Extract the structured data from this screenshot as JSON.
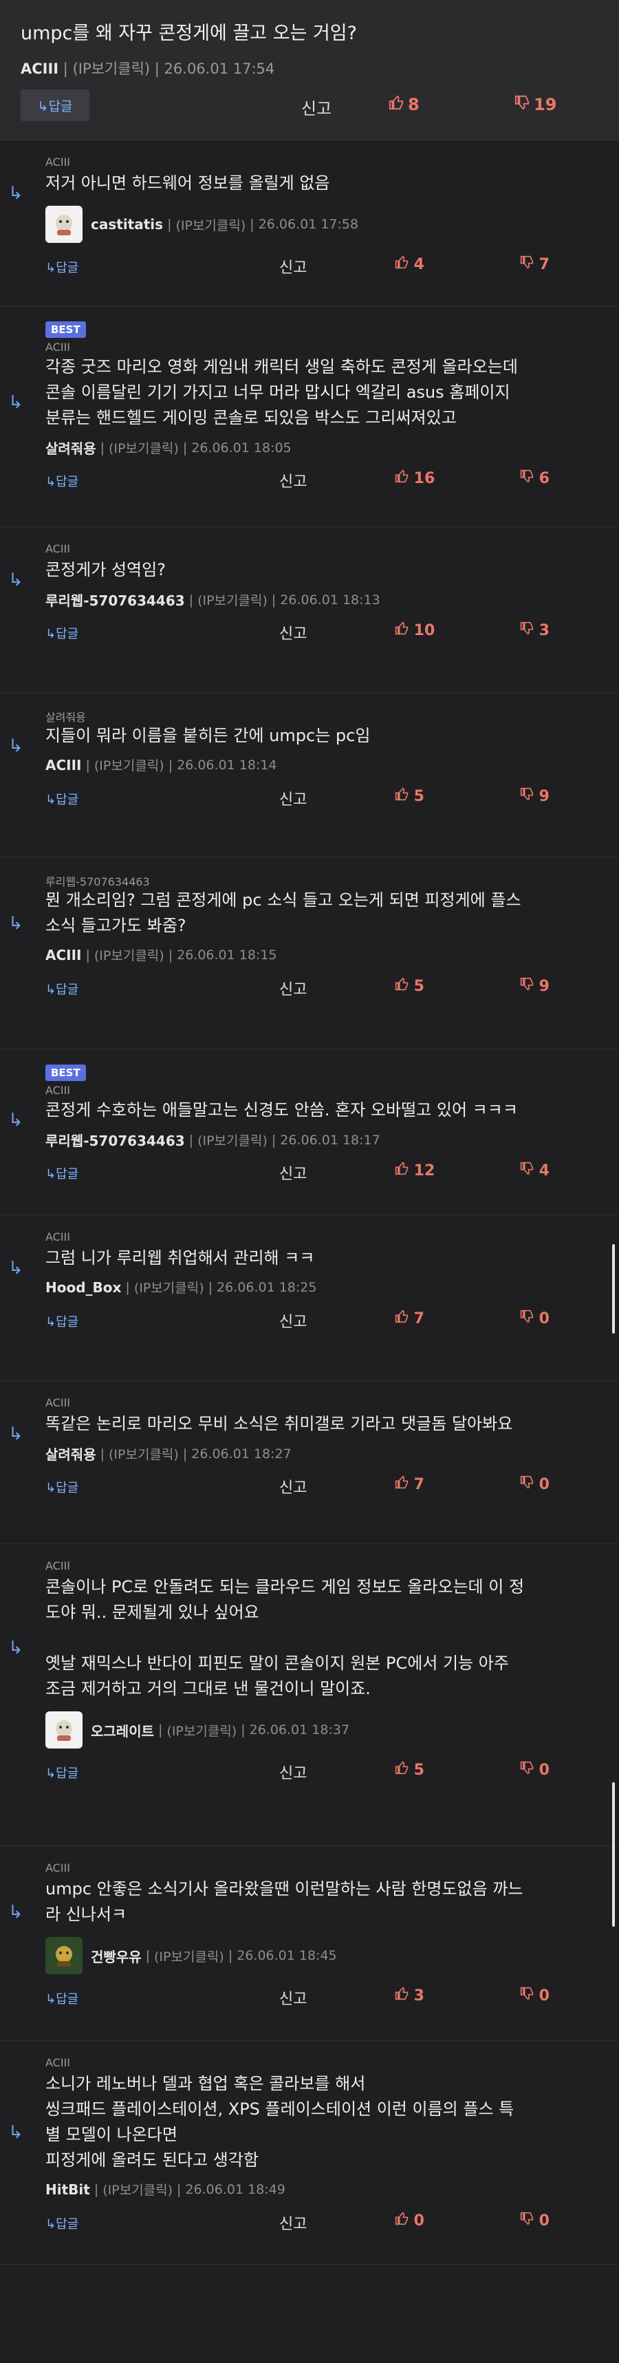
{
  "post": {
    "title": "umpc를 왜 자꾸 콘정게에 끌고 오는 거임?",
    "author": "ACIII",
    "ip": "(IP보기클릭)",
    "date": "26.06.01 17:54",
    "reply_label": "↳답글",
    "report_label": "신고",
    "up": "8",
    "down": "19"
  },
  "comments": [
    {
      "parent": "ACIII",
      "best": "",
      "text": "저거 아니면 하드웨어 정보를 올릴게 없음",
      "nick": "castitatis",
      "ip": "(IP보기클릭)",
      "date": "26.06.01 17:58",
      "reply": "↳답글",
      "report": "신고",
      "up": "4",
      "down": "7"
    },
    {
      "parent": "ACIII",
      "best": "BEST",
      "text": "각종 굿즈 마리오 영화 게임내 캐릭터 생일 축하도 콘정게 올라오는데\n콘솔 이름달린 기기 가지고 너무 머라 맙시다 엑갈리 asus 홈페이지\n분류는 핸드헬드 게이밍 콘솔로 되있음 박스도 그리써져있고",
      "nick": "살려줘용",
      "ip": "(IP보기클릭)",
      "date": "26.06.01 18:05",
      "reply": "↳답글",
      "report": "신고",
      "up": "16",
      "down": "6"
    },
    {
      "parent": "ACIII",
      "best": "",
      "text": "콘정게가 성역임?",
      "nick": "루리웹-5707634463",
      "ip": "(IP보기클릭)",
      "date": "26.06.01 18:13",
      "reply": "↳답글",
      "report": "신고",
      "up": "10",
      "down": "3"
    },
    {
      "parent": "살려줘용",
      "best": "",
      "text": "지들이 뭐라 이름을 붙히든 간에 umpc는 pc임",
      "nick": "ACIII",
      "ip": "(IP보기클릭)",
      "date": "26.06.01 18:14",
      "reply": "↳답글",
      "report": "신고",
      "up": "5",
      "down": "9"
    },
    {
      "parent": "루리웹-5707634463",
      "best": "",
      "text": "뭔 개소리임? 그럼 콘정게에 pc 소식 들고 오는게 되면 피정게에 플스\n소식 들고가도 봐줌?",
      "nick": "ACIII",
      "ip": "(IP보기클릭)",
      "date": "26.06.01 18:15",
      "reply": "↳답글",
      "report": "신고",
      "up": "5",
      "down": "9"
    },
    {
      "parent": "ACIII",
      "best": "BEST",
      "text": "콘정게 수호하는 애들말고는 신경도 안씀. 혼자 오바떨고 있어 ㅋㅋㅋ",
      "nick": "루리웹-5707634463",
      "ip": "(IP보기클릭)",
      "date": "26.06.01 18:17",
      "reply": "↳답글",
      "report": "신고",
      "up": "12",
      "down": "4"
    },
    {
      "parent": "ACIII",
      "best": "",
      "text": "그럼 니가 루리웹 취업해서 관리해 ㅋㅋ",
      "nick": "Hood_Box",
      "ip": "(IP보기클릭)",
      "date": "26.06.01 18:25",
      "reply": "↳답글",
      "report": "신고",
      "up": "7",
      "down": "0"
    },
    {
      "parent": "ACIII",
      "best": "",
      "text": "똑같은 논리로 마리오 무비 소식은 취미갤로 기라고 댓글돔 달아봐요",
      "nick": "살려줘용",
      "ip": "(IP보기클릭)",
      "date": "26.06.01 18:27",
      "reply": "↳답글",
      "report": "신고",
      "up": "7",
      "down": "0"
    },
    {
      "parent": "ACIII",
      "best": "",
      "text": "콘솔이나 PC로 안돌려도 되는 클라우드 게임 정보도 올라오는데 이 정\n도야 뭐.. 문제될게 있나 싶어요\n\n옛날 재믹스나 반다이 피핀도 말이 콘솔이지 원본 PC에서 기능 아주\n조금 제거하고 거의 그대로 낸 물건이니 말이죠.",
      "nick": "오그레이트",
      "ip": "(IP보기클릭)",
      "date": "26.06.01 18:37",
      "reply": "↳답글",
      "report": "신고",
      "up": "5",
      "down": "0"
    },
    {
      "parent": "ACIII",
      "best": "",
      "text": "umpc 안좋은 소식기사 올라왔을땐 이런말하는 사람 한명도없음 까느\n라 신나서ㅋ",
      "nick": "건빵우유",
      "ip": "(IP보기클릭)",
      "date": "26.06.01 18:45",
      "reply": "↳답글",
      "report": "신고",
      "up": "3",
      "down": "0"
    },
    {
      "parent": "ACIII",
      "best": "",
      "text": "소니가 레노버나 델과 협업 혹은 콜라보를 해서\n씽크패드 플레이스테이션, XPS 플레이스테이션 이런 이름의 플스 특\n별 모델이 나온다면\n피정게에 올려도 된다고 생각함",
      "nick": "HitBit",
      "ip": "(IP보기클릭)",
      "date": "26.06.01 18:49",
      "reply": "↳답글",
      "report": "신고",
      "up": "0",
      "down": "0"
    }
  ]
}
